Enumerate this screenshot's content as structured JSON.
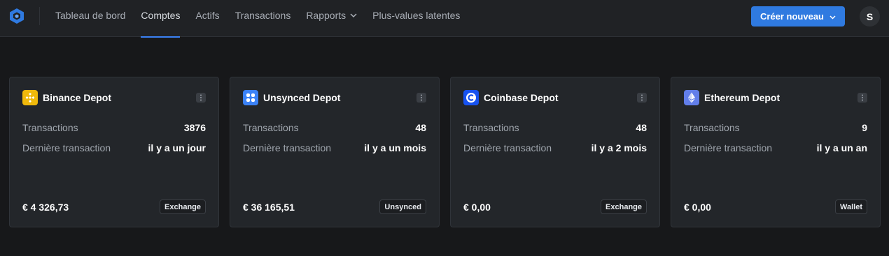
{
  "nav": {
    "items": [
      {
        "label": "Tableau de bord"
      },
      {
        "label": "Comptes"
      },
      {
        "label": "Actifs"
      },
      {
        "label": "Transactions"
      },
      {
        "label": "Rapports"
      },
      {
        "label": "Plus-values latentes"
      }
    ],
    "active": "Comptes"
  },
  "header": {
    "create_label": "Créer nouveau",
    "avatar_initial": "S"
  },
  "cards": [
    {
      "name": "Binance Depot",
      "icon": "binance-icon",
      "icon_color": "#f0b90b",
      "tx_label": "Transactions",
      "tx_count": "3876",
      "last_label": "Dernière transaction",
      "last_value": "il y a un jour",
      "amount": "€ 4 326,73",
      "badge": "Exchange"
    },
    {
      "name": "Unsynced Depot",
      "icon": "grid-icon",
      "icon_color": "#3b82f6",
      "tx_label": "Transactions",
      "tx_count": "48",
      "last_label": "Dernière transaction",
      "last_value": "il y a un mois",
      "amount": "€ 36 165,51",
      "badge": "Unsynced"
    },
    {
      "name": "Coinbase Depot",
      "icon": "coinbase-icon",
      "icon_color": "#1652f0",
      "tx_label": "Transactions",
      "tx_count": "48",
      "last_label": "Dernière transaction",
      "last_value": "il y a 2 mois",
      "amount": "€ 0,00",
      "badge": "Exchange"
    },
    {
      "name": "Ethereum Depot",
      "icon": "ethereum-icon",
      "icon_color": "#627eea",
      "tx_label": "Transactions",
      "tx_count": "9",
      "last_label": "Dernière transaction",
      "last_value": "il y a un an",
      "amount": "€ 0,00",
      "badge": "Wallet"
    }
  ],
  "colors": {
    "accent": "#2f7ae0",
    "background": "#17181a",
    "card": "#23262a"
  }
}
